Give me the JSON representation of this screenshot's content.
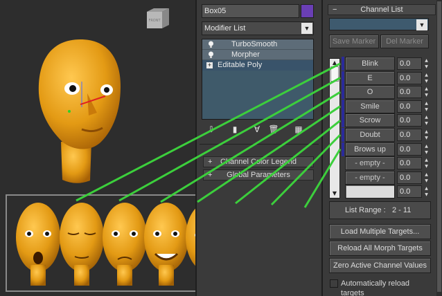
{
  "viewport": {
    "cube_label": "FRONT",
    "face_color": "#e7a21a"
  },
  "modify_panel": {
    "object_name": "Box05",
    "object_color": "#6a3fb5",
    "modifier_list_label": "Modifier List",
    "stack": [
      {
        "label": "TurboSmooth",
        "kind": "modifier"
      },
      {
        "label": "Morpher",
        "kind": "modifier"
      },
      {
        "label": "Editable Poly",
        "kind": "base"
      }
    ],
    "rollouts": [
      {
        "label": "Channel Color Legend",
        "state": "+"
      },
      {
        "label": "Global Parameters",
        "state": "+"
      }
    ]
  },
  "channel_list": {
    "header": "Channel List",
    "header_state": "−",
    "save_marker_label": "Save Marker",
    "del_marker_label": "Del Marker",
    "channels": [
      {
        "name": "Blink",
        "value": "0.0",
        "state": "active"
      },
      {
        "name": "E",
        "value": "0.0",
        "state": "active"
      },
      {
        "name": "O",
        "value": "0.0",
        "state": "active"
      },
      {
        "name": "Smile",
        "value": "0.0",
        "state": "active"
      },
      {
        "name": "Scrow",
        "value": "0.0",
        "state": "active"
      },
      {
        "name": "Doubt",
        "value": "0.0",
        "state": "active"
      },
      {
        "name": "Brows up",
        "value": "0.0",
        "state": "active"
      },
      {
        "name": "- empty -",
        "value": "0.0",
        "state": "empty"
      },
      {
        "name": "- empty -",
        "value": "0.0",
        "state": "empty"
      },
      {
        "name": "",
        "value": "0.0",
        "state": "blank"
      }
    ],
    "list_range_label": "List Range :",
    "list_range_value": "2 - 11",
    "load_multiple_label": "Load Multiple Targets...",
    "reload_all_label": "Reload All Morph Targets",
    "zero_active_label": "Zero Active Channel Values",
    "auto_reload_label": "Automatically reload targets",
    "auto_reload_checked": false,
    "channel_bar_color": "#2a2a9a",
    "link_line_color": "#3ccf3c"
  }
}
